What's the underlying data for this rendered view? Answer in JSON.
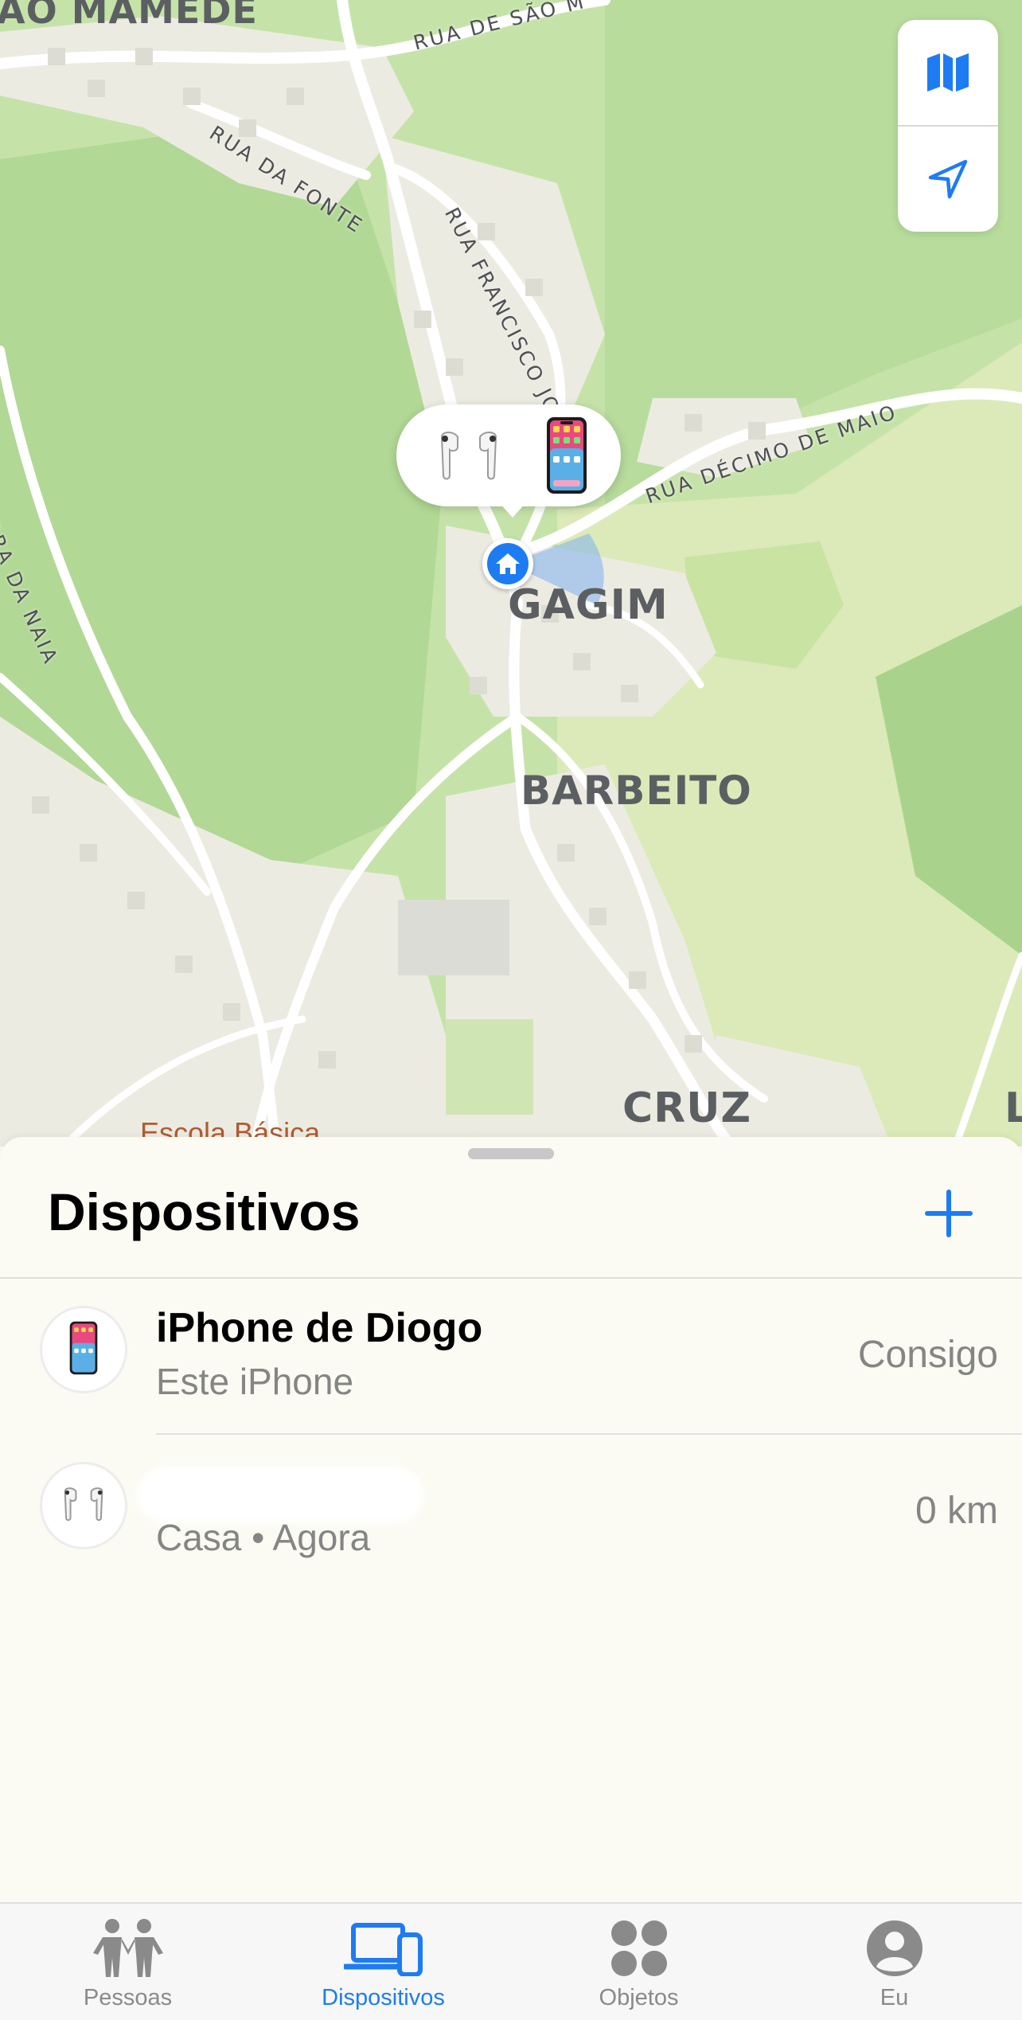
{
  "map": {
    "place_labels": [
      "GAGIM",
      "BARBEITO",
      "CRUZ",
      "AO MAMEDE",
      "L"
    ],
    "street_labels": [
      "RUA DE SÃO M",
      "RUA DA FONTE",
      "RUA FRANCISCO JO",
      "RUA DÉCIMO DE MAIO",
      "RRA DA NAIA"
    ],
    "poi_label": "Escola Básica",
    "controls": [
      "map-icon",
      "location-arrow-icon"
    ],
    "callout_icons": [
      "airpods-icon",
      "iphone-icon"
    ],
    "pin_icon": "house-icon"
  },
  "sheet": {
    "title": "Dispositivos",
    "add_icon": "plus-icon",
    "devices": [
      {
        "name": "iPhone de Diogo",
        "subtitle": "Este iPhone",
        "status": "Consigo",
        "icon": "iphone-icon"
      },
      {
        "name": "",
        "subtitle": "Casa • Agora",
        "status": "0 km",
        "icon": "airpods-icon"
      }
    ]
  },
  "tabbar": {
    "tabs": [
      {
        "label": "Pessoas",
        "icon": "people-icon",
        "active": false
      },
      {
        "label": "Dispositivos",
        "icon": "devices-icon",
        "active": true
      },
      {
        "label": "Objetos",
        "icon": "items-icon",
        "active": false
      },
      {
        "label": "Eu",
        "icon": "person-icon",
        "active": false
      }
    ]
  },
  "colors": {
    "accent": "#1e7cf2",
    "map_green": "#b9dca0",
    "map_light": "#d8e9b6",
    "road": "#ffffff",
    "urban": "#ecebe2"
  }
}
